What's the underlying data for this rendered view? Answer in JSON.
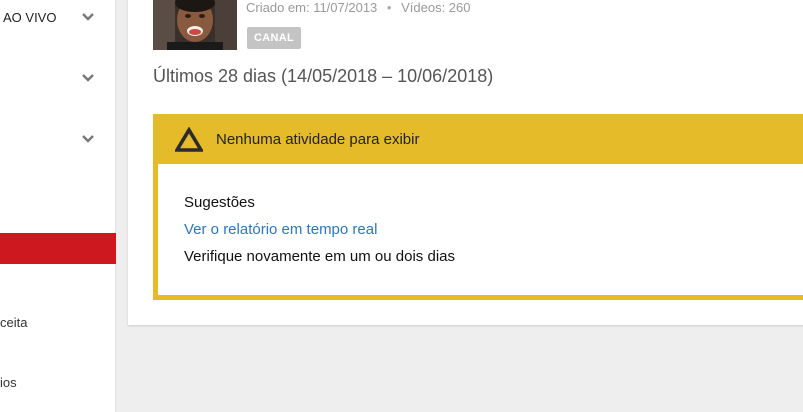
{
  "sidebar": {
    "items": [
      {
        "label": "AO VIVO",
        "has_chevron": true
      },
      {
        "label": "",
        "has_chevron": true
      },
      {
        "label": "",
        "has_chevron": true
      },
      {
        "label": "",
        "active": true
      },
      {
        "label": "ceita"
      },
      {
        "label": "ios"
      }
    ],
    "active_color": "#cc181e"
  },
  "channel": {
    "created_label": "Criado em: 11/07/2013",
    "videos_label": "Vídeos: 260",
    "separator": "•",
    "type_badge": "CANAL"
  },
  "period_title": "Últimos 28 dias (14/05/2018 – 10/06/2018)",
  "alert": {
    "title": "Nenhuma atividade para exibir",
    "color": "#e6bb2a",
    "icon": "warning-triangle-icon",
    "suggestions_title": "Sugestões",
    "suggestion_link": "Ver o relatório em tempo real",
    "suggestion_text": "Verifique novamente em um ou dois dias"
  }
}
